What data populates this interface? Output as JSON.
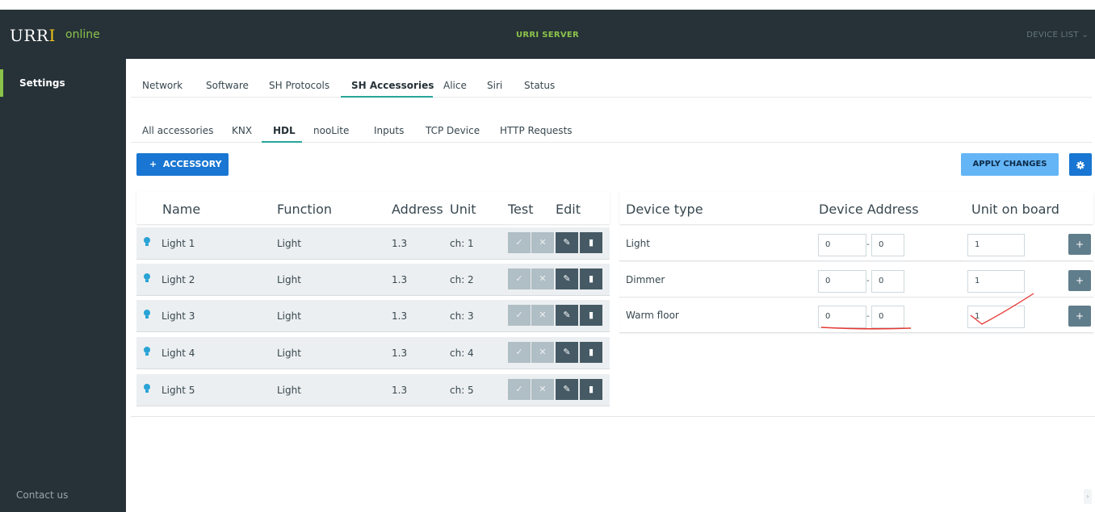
{
  "header": {
    "logo_text": "URR",
    "logo_accent": "I",
    "status": "online",
    "title": "URRI SERVER",
    "device_list": "DEVICE LIST"
  },
  "sidebar": {
    "settings": "Settings",
    "contact": "Contact us"
  },
  "tabs_main": [
    "Network",
    "Software",
    "SH Protocols",
    "SH Accessories",
    "Alice",
    "Siri",
    "Status"
  ],
  "tabs_sub": [
    "All accessories",
    "KNX",
    "HDL",
    "nooLite",
    "Inputs",
    "TCP Device",
    "HTTP Requests"
  ],
  "toolbar": {
    "add_label": "ACCESSORY",
    "add_icon": "+",
    "apply_label": "APPLY CHANGES"
  },
  "left_table": {
    "headers": {
      "name": "Name",
      "function": "Function",
      "address": "Address",
      "unit": "Unit",
      "test": "Test",
      "edit": "Edit"
    },
    "rows": [
      {
        "name": "Light 1",
        "function": "Light",
        "address": "1.3",
        "unit": "ch: 1"
      },
      {
        "name": "Light 2",
        "function": "Light",
        "address": "1.3",
        "unit": "ch: 2"
      },
      {
        "name": "Light 3",
        "function": "Light",
        "address": "1.3",
        "unit": "ch: 3"
      },
      {
        "name": "Light 4",
        "function": "Light",
        "address": "1.3",
        "unit": "ch: 4"
      },
      {
        "name": "Light 5",
        "function": "Light",
        "address": "1.3",
        "unit": "ch: 5"
      }
    ]
  },
  "right_table": {
    "headers": {
      "type": "Device type",
      "address": "Device Address",
      "unit": "Unit on board"
    },
    "rows": [
      {
        "type": "Light",
        "addr1": "0",
        "addr2": "0",
        "unit": "1"
      },
      {
        "type": "Dimmer",
        "addr1": "0",
        "addr2": "0",
        "unit": "1"
      },
      {
        "type": "Warm floor",
        "addr1": "0",
        "addr2": "0",
        "unit": "1"
      }
    ]
  },
  "colors": {
    "topbar": "#263238",
    "online": "#8bc34a",
    "primary": "#1976d2",
    "apply": "#64b5f6",
    "tab_underline": "#26a69a",
    "annotation": "#e53935"
  }
}
